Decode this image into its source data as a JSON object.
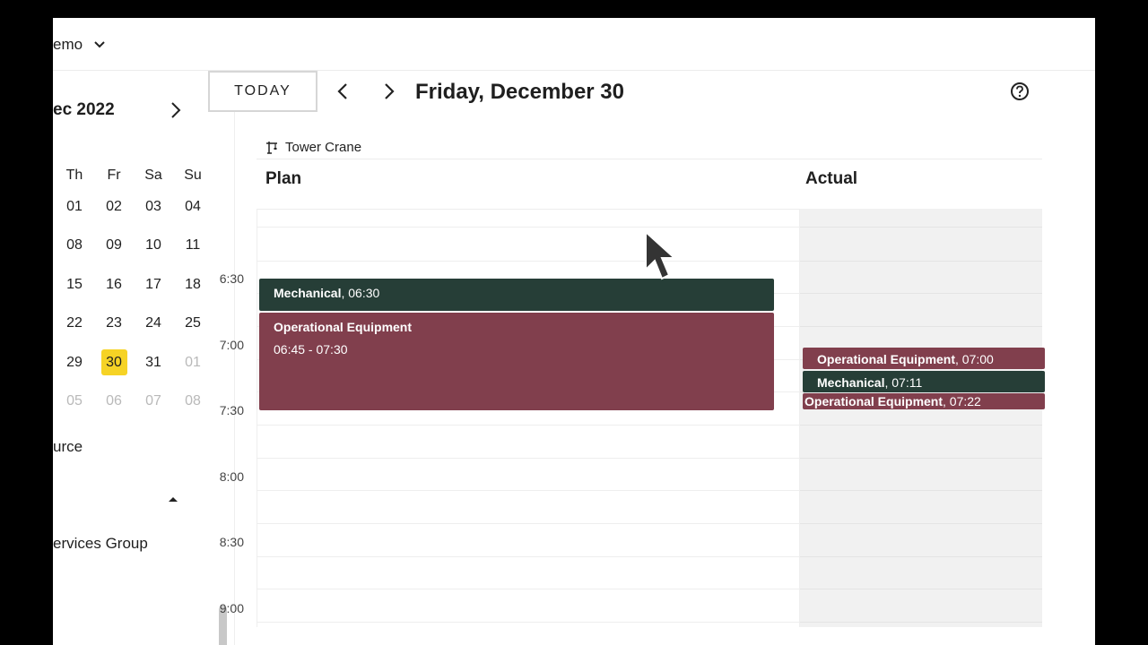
{
  "project": {
    "name": "emo"
  },
  "sidebar": {
    "month_label": "ec 2022",
    "weekdays": [
      "Th",
      "Fr",
      "Sa",
      "Su"
    ],
    "weeks": [
      [
        {
          "d": "01"
        },
        {
          "d": "02"
        },
        {
          "d": "03"
        },
        {
          "d": "04"
        }
      ],
      [
        {
          "d": "08"
        },
        {
          "d": "09"
        },
        {
          "d": "10"
        },
        {
          "d": "11"
        }
      ],
      [
        {
          "d": "15"
        },
        {
          "d": "16"
        },
        {
          "d": "17"
        },
        {
          "d": "18"
        }
      ],
      [
        {
          "d": "22"
        },
        {
          "d": "23"
        },
        {
          "d": "24"
        },
        {
          "d": "25"
        }
      ],
      [
        {
          "d": "29"
        },
        {
          "d": "30",
          "selected": true
        },
        {
          "d": "31"
        },
        {
          "d": "01",
          "muted": true
        }
      ],
      [
        {
          "d": "05",
          "muted": true
        },
        {
          "d": "06",
          "muted": true
        },
        {
          "d": "07",
          "muted": true
        },
        {
          "d": "08",
          "muted": true
        }
      ]
    ],
    "resource_label": "urce",
    "group_label": "ervices Group"
  },
  "toolbar": {
    "today_label": "TODAY",
    "date_title": "Friday, December 30"
  },
  "resource": {
    "name": "Tower Crane"
  },
  "columns": {
    "plan": "Plan",
    "actual": "Actual"
  },
  "times": [
    "6:30",
    "7:00",
    "7:30",
    "8:00",
    "8:30",
    "9:00"
  ],
  "plan_events": [
    {
      "title": "Mechanical",
      "time": ", 06:30",
      "color": "#263e37"
    },
    {
      "title": "Operational Equipment",
      "range": "06:45 - 07:30",
      "color": "#813f4d"
    }
  ],
  "actual_events": [
    {
      "title": "Operational Equipment",
      "time": ", 07:00",
      "color": "#813f4d"
    },
    {
      "title": "Mechanical",
      "time": ", 07:11",
      "color": "#263e37"
    },
    {
      "title": "Operational Equipment",
      "time": ", 07:22",
      "color": "#813f4d"
    }
  ],
  "colors": {
    "selected_day": "#f6d325",
    "event_green": "#263e37",
    "event_red": "#813f4d"
  },
  "icons": [
    "chevron-down-icon",
    "chevron-right-icon",
    "chevron-left-icon",
    "help-circle-icon",
    "crane-icon",
    "caret-up-icon",
    "mouse-pointer-icon"
  ]
}
